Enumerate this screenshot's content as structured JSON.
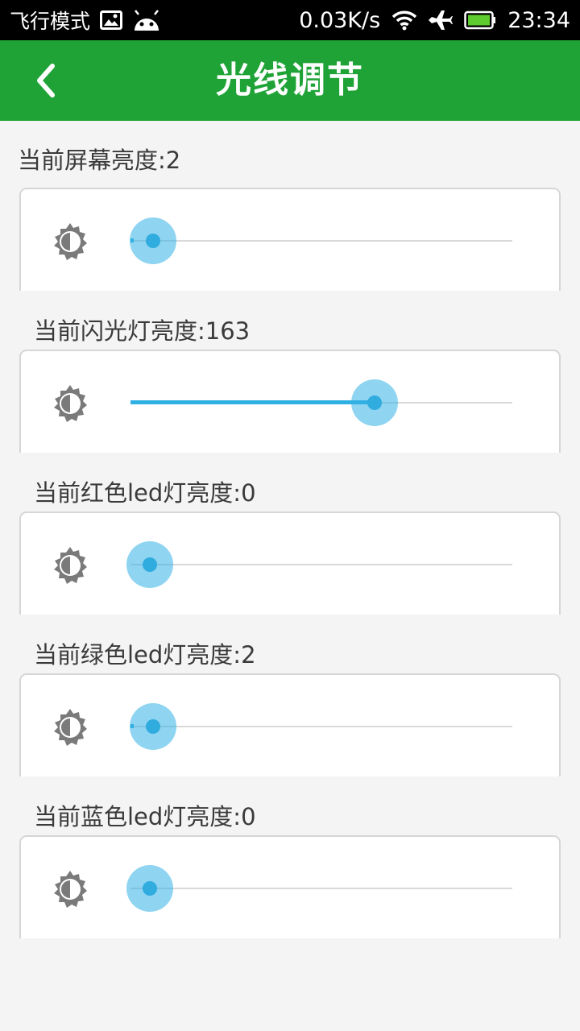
{
  "status_bar": {
    "mode": "飞行模式",
    "speed": "0.03K/s",
    "time": "23:34",
    "icons": [
      "image-icon",
      "android-icon",
      "wifi-icon",
      "airplane-icon",
      "battery-icon"
    ]
  },
  "header": {
    "title": "光线调节",
    "background": "#1fa337",
    "back_icon": "chevron-left-icon"
  },
  "sliders": [
    {
      "label": "当前屏幕亮度:2",
      "value": 2,
      "max": 255
    },
    {
      "label": "当前闪光灯亮度:163",
      "value": 163,
      "max": 255
    },
    {
      "label": "当前红色led灯亮度:0",
      "value": 0,
      "max": 255
    },
    {
      "label": "当前绿色led灯亮度:2",
      "value": 2,
      "max": 255
    },
    {
      "label": "当前蓝色led灯亮度:0",
      "value": 0,
      "max": 255
    }
  ],
  "accent": "#33b1e5"
}
